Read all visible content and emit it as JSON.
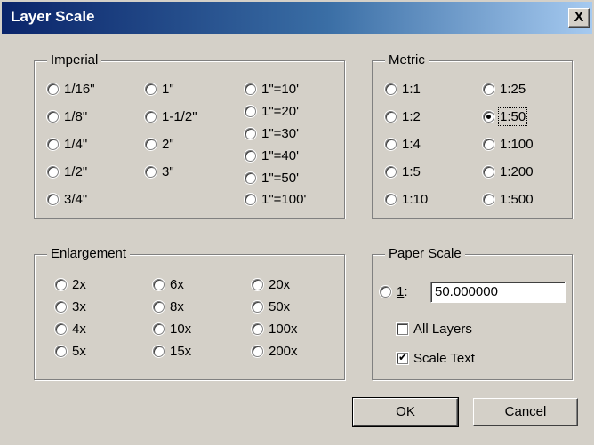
{
  "window": {
    "title": "Layer Scale",
    "close_label": "X"
  },
  "imperial": {
    "title": "Imperial",
    "options": [
      "1/16\"",
      "1/8\"",
      "1/4\"",
      "1/2\"",
      "3/4\"",
      "1\"",
      "1-1/2\"",
      "2\"",
      "3\"",
      "1\"=10'",
      "1\"=20'",
      "1\"=30'",
      "1\"=40'",
      "1\"=50'",
      "1\"=100'"
    ]
  },
  "metric": {
    "title": "Metric",
    "options": [
      "1:1",
      "1:2",
      "1:4",
      "1:5",
      "1:10",
      "1:25",
      "1:50",
      "1:100",
      "1:200",
      "1:500"
    ],
    "selected": "1:50"
  },
  "enlargement": {
    "title": "Enlargement",
    "options": [
      "2x",
      "3x",
      "4x",
      "5x",
      "6x",
      "8x",
      "10x",
      "15x",
      "20x",
      "50x",
      "100x",
      "200x"
    ]
  },
  "paper_scale": {
    "title": "Paper Scale",
    "radio_label": "1",
    "colon": ":",
    "value": "50.000000",
    "all_layers": {
      "label": "All Layers",
      "checked": false
    },
    "scale_text": {
      "label": "Scale Text",
      "checked": true
    }
  },
  "buttons": {
    "ok": "OK",
    "cancel": "Cancel"
  }
}
